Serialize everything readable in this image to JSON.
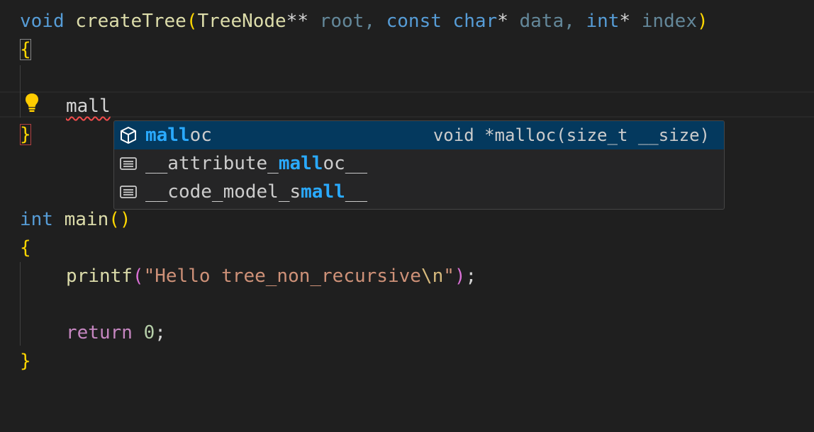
{
  "editor": {
    "lines": {
      "l1": {
        "kw_void": "void",
        "fn_name": "createTree",
        "open_paren": "(",
        "type_treenode": "TreeNode",
        "stars": "**",
        "p_root": " root",
        "comma1": ", ",
        "kw_const": "const",
        "kw_char": " char",
        "star1": "*",
        "p_data": " data",
        "comma2": ", ",
        "kw_int": "int",
        "star2": "*",
        "p_index": " index",
        "close_paren": ")"
      },
      "l2": {
        "brace": "{"
      },
      "l4": {
        "typed": "mall"
      },
      "l5": {
        "brace": "}"
      },
      "l8": {
        "kw_int": "int",
        "fn_main": " main",
        "open_paren": "(",
        "close_paren": ")"
      },
      "l9": {
        "brace": "{"
      },
      "l10": {
        "fn_printf": "printf",
        "open_paren": "(",
        "str_a": "\"Hello tree_non_recursive",
        "esc": "\\n",
        "str_b": "\"",
        "close_paren": ")",
        "semi": ";"
      },
      "l12": {
        "kw_return": "return",
        "num": " 0",
        "semi": ";"
      },
      "l13": {
        "brace": "}"
      }
    },
    "lightbulb_icon": "lightbulb-icon"
  },
  "suggest": {
    "items": [
      {
        "icon": "method-cube-icon",
        "pre": "",
        "match": "mall",
        "post": "oc",
        "detail": "void *malloc(size_t __size)",
        "selected": true
      },
      {
        "icon": "text-lines-icon",
        "pre": "__attribute_",
        "match": "mall",
        "post": "oc__",
        "detail": "",
        "selected": false
      },
      {
        "icon": "text-lines-icon",
        "pre": "__code_model_s",
        "match": "mall",
        "post": "__",
        "detail": "",
        "selected": false
      }
    ]
  },
  "colors": {
    "background": "#1f1f1f",
    "keyword": "#569cd6",
    "control": "#c586c0",
    "function": "#dcdcaa",
    "string": "#ce9178",
    "bracket": "#ffd700",
    "suggest_selected": "#04395e",
    "suggest_match": "#2aaaff"
  }
}
